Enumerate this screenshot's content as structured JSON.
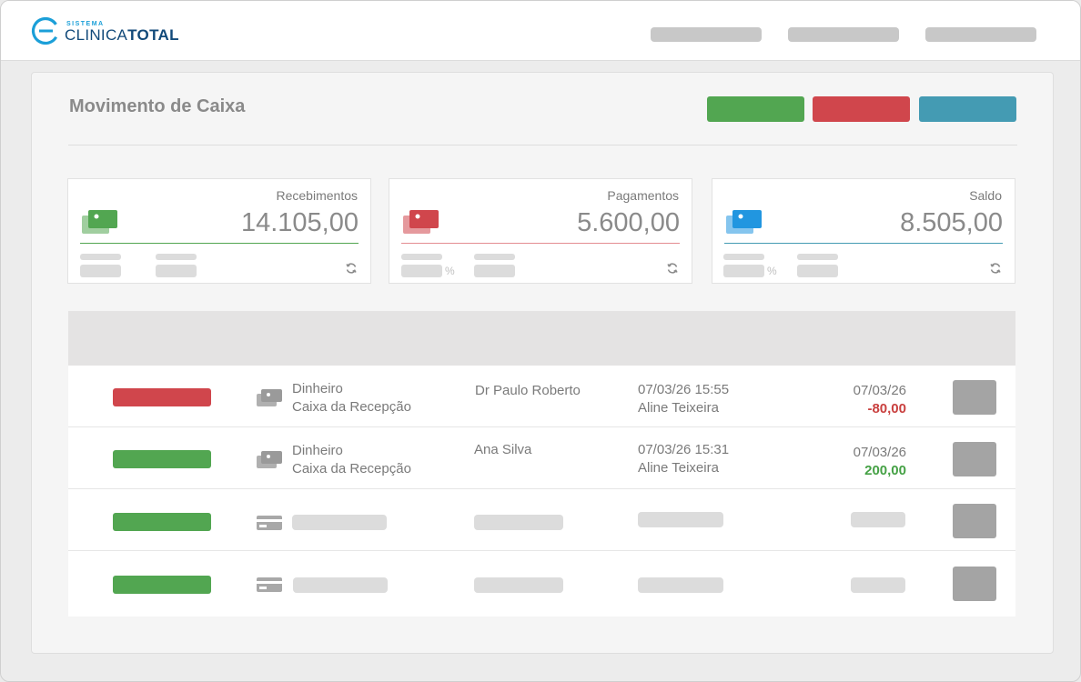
{
  "app": {
    "logo_small": "SISTEMA",
    "logo_light": "CLINICA",
    "logo_bold": "TOTAL"
  },
  "page": {
    "title": "Movimento de Caixa"
  },
  "colors": {
    "green": "#52a651",
    "red": "#d0464c",
    "teal": "#449bb3",
    "blue": "#2196e0",
    "logo_blue": "#1b9fd8",
    "logo_dark": "#124a7a"
  },
  "cards": [
    {
      "label": "Recebimentos",
      "value": "14.105,00",
      "icon": "money-icon",
      "color": "#52a651"
    },
    {
      "label": "Pagamentos",
      "value": "5.600,00",
      "icon": "money-icon",
      "color": "#d0464c",
      "pct": "%"
    },
    {
      "label": "Saldo",
      "value": "8.505,00",
      "icon": "money-icon",
      "color": "#2196e0",
      "pct": "%"
    }
  ],
  "rows": [
    {
      "status_color": "#d0464c",
      "method": "Dinheiro",
      "account": "Caixa da Recepção",
      "person": "Dr Paulo Roberto",
      "datetime": "07/03/26 15:55",
      "user": "Aline Teixeira",
      "date": "07/03/26",
      "amount": "-80,00",
      "amount_color": "#c9403f"
    },
    {
      "status_color": "#52a651",
      "method": "Dinheiro",
      "account": "Caixa da Recepção",
      "person": "Ana Silva",
      "datetime": "07/03/26 15:31",
      "user": "Aline Teixeira",
      "date": "07/03/26",
      "amount": "200,00",
      "amount_color": "#45a145"
    }
  ]
}
